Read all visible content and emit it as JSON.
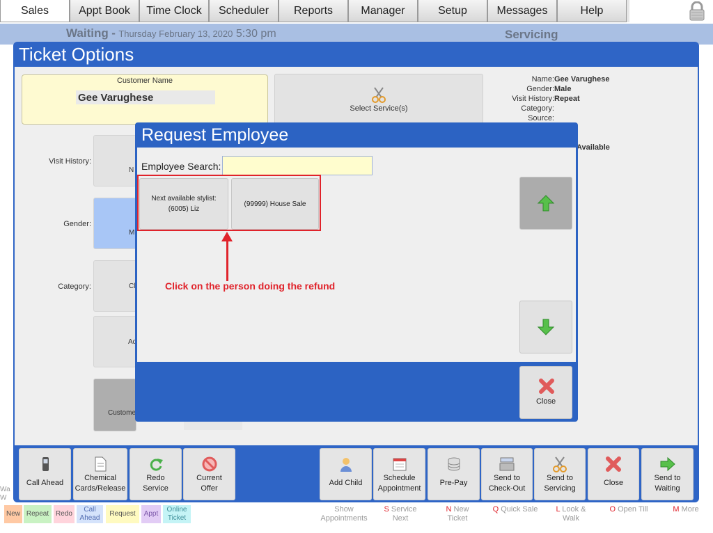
{
  "nav": {
    "tabs": [
      "Sales",
      "Appt Book",
      "Time Clock",
      "Scheduler",
      "Reports",
      "Manager",
      "Setup",
      "Messages",
      "Help"
    ],
    "active": "Sales",
    "lock_icon": "lock-icon"
  },
  "status": {
    "left_status": "Waiting",
    "separator": "-",
    "date": "Thursday February 13, 2020",
    "time": "5:30 pm",
    "right_status": "Servicing"
  },
  "ticket": {
    "title": "Ticket Options",
    "customer_label": "Customer Name",
    "customer_name": "Gee Varughese",
    "select_services": "Select Service(s)",
    "info": [
      {
        "k": "Name:",
        "v": "Gee Varughese"
      },
      {
        "k": "Gender:",
        "v": "Male"
      },
      {
        "k": "Visit History:",
        "v": "Repeat"
      },
      {
        "k": "Category:",
        "v": ""
      },
      {
        "k": "Source:",
        "v": ""
      }
    ],
    "available": "Available",
    "left_labels": {
      "visit": "Visit History:",
      "gender": "Gender:",
      "category": "Category:"
    },
    "fragments": {
      "n": "N",
      "m": "M",
      "cl": "Cl",
      "ad": "Ad",
      "custom": "Custome"
    }
  },
  "dialog": {
    "title": "Request Employee",
    "search_label": "Employee Search:",
    "search_value": "",
    "employees": [
      "Next available stylist:\n(6005) Liz",
      "(99999) House Sale"
    ],
    "annotation": "Click on the person doing the refund",
    "close_label": "Close"
  },
  "toolbar": {
    "left": [
      {
        "label": "Call Ahead",
        "icon": "phone-icon"
      },
      {
        "label": "Chemical\nCards/Release",
        "icon": "document-icon"
      },
      {
        "label": "Redo\nService",
        "icon": "redo-icon"
      },
      {
        "label": "Current\nOffer",
        "icon": "no-offer-icon"
      }
    ],
    "right": [
      {
        "label": "Add Child",
        "icon": "child-icon"
      },
      {
        "label": "Schedule\nAppointment",
        "icon": "calendar-icon"
      },
      {
        "label": "Pre-Pay",
        "icon": "coins-icon"
      },
      {
        "label": "Send to\nCheck-Out",
        "icon": "register-icon"
      },
      {
        "label": "Send to\nServicing",
        "icon": "scissors-icon"
      },
      {
        "label": "Close",
        "icon": "close-icon"
      },
      {
        "label": "Send to\nWaiting",
        "icon": "arrow-right-icon"
      }
    ]
  },
  "legend": [
    {
      "label": "New",
      "color": "#ffc9a4"
    },
    {
      "label": "Repeat",
      "color": "#c9f2c3"
    },
    {
      "label": "Redo",
      "color": "#ffd4dc"
    },
    {
      "label": "Call\nAhead",
      "color": "#d5e3fb"
    },
    {
      "label": "Request",
      "color": "#fffac0"
    },
    {
      "label": "Appt",
      "color": "#e2ccf5"
    },
    {
      "label": "Online\nTicket",
      "color": "#c5f4f6"
    }
  ],
  "shortcuts": [
    {
      "key": "",
      "label": "Show\nAppointments"
    },
    {
      "key": "S",
      "label": "Service\nNext"
    },
    {
      "key": "N",
      "label": "New\nTicket"
    },
    {
      "key": "Q",
      "label": "Quick Sale"
    },
    {
      "key": "L",
      "label": "Look &\nWalk"
    },
    {
      "key": "O",
      "label": "Open Till"
    },
    {
      "key": "M",
      "label": "More"
    }
  ],
  "edge_text": "Wa\nW"
}
